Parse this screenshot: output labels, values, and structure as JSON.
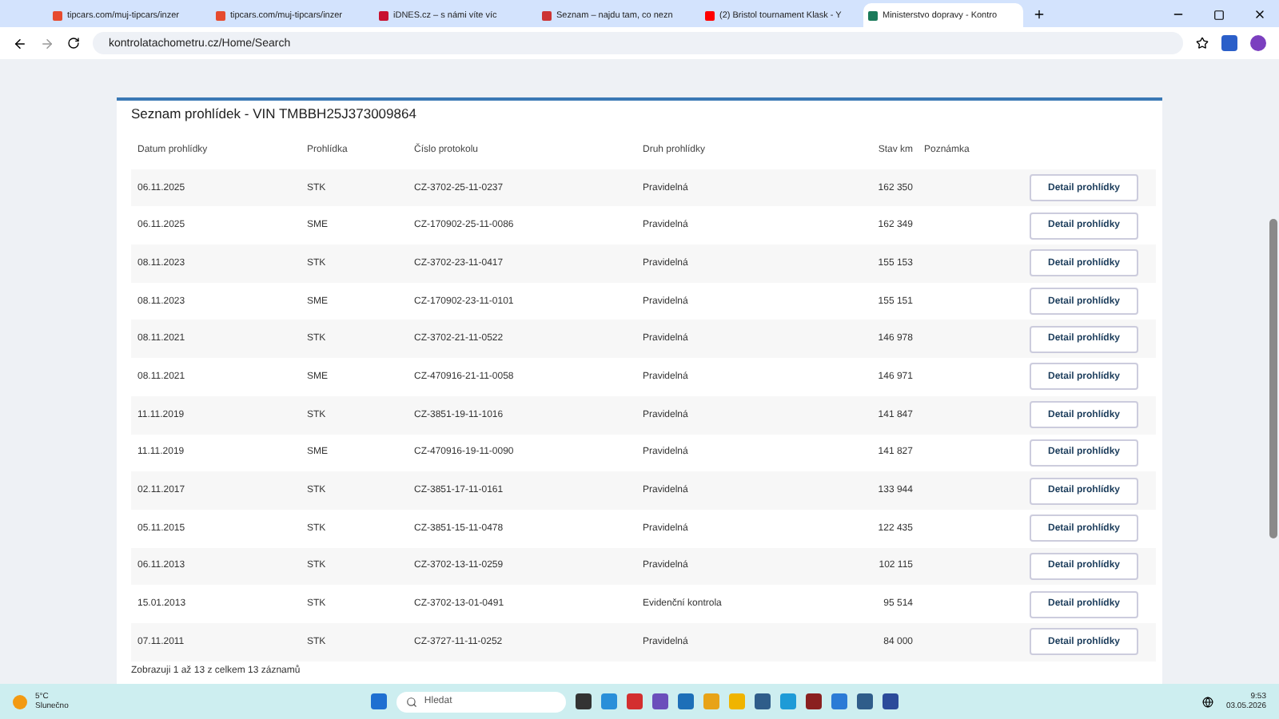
{
  "browser": {
    "tabs": [
      {
        "title": "tipcars.com/muj-tipcars/inzer",
        "selected": false
      },
      {
        "title": "tipcars.com/muj-tipcars/inzer",
        "selected": false
      },
      {
        "title": "iDNES.cz – s námi víte víc",
        "selected": false
      },
      {
        "title": "Seznam – najdu tam, co nezn",
        "selected": false
      },
      {
        "title": "(2) Bristol tournament Klask - Y",
        "selected": false
      },
      {
        "title": "Ministerstvo dopravy - Kontro",
        "selected": true
      }
    ],
    "address": "kontrolatachometru.cz/Home/Search"
  },
  "card": {
    "title": "Seznam prohlídek - VIN TMBBH25J373009864",
    "columns": [
      "Datum prohlídky",
      "Prohlídka",
      "Číslo protokolu",
      "Druh prohlídky",
      "Stav km",
      "Poznámka"
    ],
    "rows": [
      {
        "date": "06.11.2025",
        "type": "STK",
        "protocol": "CZ-3702-25-11-0237",
        "kind": "Pravidelná",
        "km": "162 350",
        "button": "Detail prohlídky"
      },
      {
        "date": "06.11.2025",
        "type": "SME",
        "protocol": "CZ-170902-25-11-0086",
        "kind": "Pravidelná",
        "km": "162 349",
        "button": "Detail prohlídky"
      },
      {
        "date": "08.11.2023",
        "type": "STK",
        "protocol": "CZ-3702-23-11-0417",
        "kind": "Pravidelná",
        "km": "155 153",
        "button": "Detail prohlídky"
      },
      {
        "date": "08.11.2023",
        "type": "SME",
        "protocol": "CZ-170902-23-11-0101",
        "kind": "Pravidelná",
        "km": "155 151",
        "button": "Detail prohlídky"
      },
      {
        "date": "08.11.2021",
        "type": "STK",
        "protocol": "CZ-3702-21-11-0522",
        "kind": "Pravidelná",
        "km": "146 978",
        "button": "Detail prohlídky"
      },
      {
        "date": "08.11.2021",
        "type": "SME",
        "protocol": "CZ-470916-21-11-0058",
        "kind": "Pravidelná",
        "km": "146 971",
        "button": "Detail prohlídky"
      },
      {
        "date": "11.11.2019",
        "type": "STK",
        "protocol": "CZ-3851-19-11-1016",
        "kind": "Pravidelná",
        "km": "141 847",
        "button": "Detail prohlídky"
      },
      {
        "date": "11.11.2019",
        "type": "SME",
        "protocol": "CZ-470916-19-11-0090",
        "kind": "Pravidelná",
        "km": "141 827",
        "button": "Detail prohlídky"
      },
      {
        "date": "02.11.2017",
        "type": "STK",
        "protocol": "CZ-3851-17-11-0161",
        "kind": "Pravidelná",
        "km": "133 944",
        "button": "Detail prohlídky"
      },
      {
        "date": "05.11.2015",
        "type": "STK",
        "protocol": "CZ-3851-15-11-0478",
        "kind": "Pravidelná",
        "km": "122 435",
        "button": "Detail prohlídky"
      },
      {
        "date": "06.11.2013",
        "type": "STK",
        "protocol": "CZ-3702-13-11-0259",
        "kind": "Pravidelná",
        "km": "102 115",
        "button": "Detail prohlídky"
      },
      {
        "date": "15.01.2013",
        "type": "STK",
        "protocol": "CZ-3702-13-01-0491",
        "kind": "Evidenční kontrola",
        "km": "95 514",
        "button": "Detail prohlídky"
      },
      {
        "date": "07.11.2011",
        "type": "STK",
        "protocol": "CZ-3727-11-11-0252",
        "kind": "Pravidelná",
        "km": "84 000",
        "button": "Detail prohlídky"
      }
    ],
    "footer": "Zobrazuji 1 až 13 z celkem 13 záznamů"
  },
  "taskbar": {
    "weather_temp": "5°C",
    "weather_text": "Slunečno",
    "search_placeholder": "Hledat",
    "time": "9:53",
    "date": "03.05.2026"
  }
}
